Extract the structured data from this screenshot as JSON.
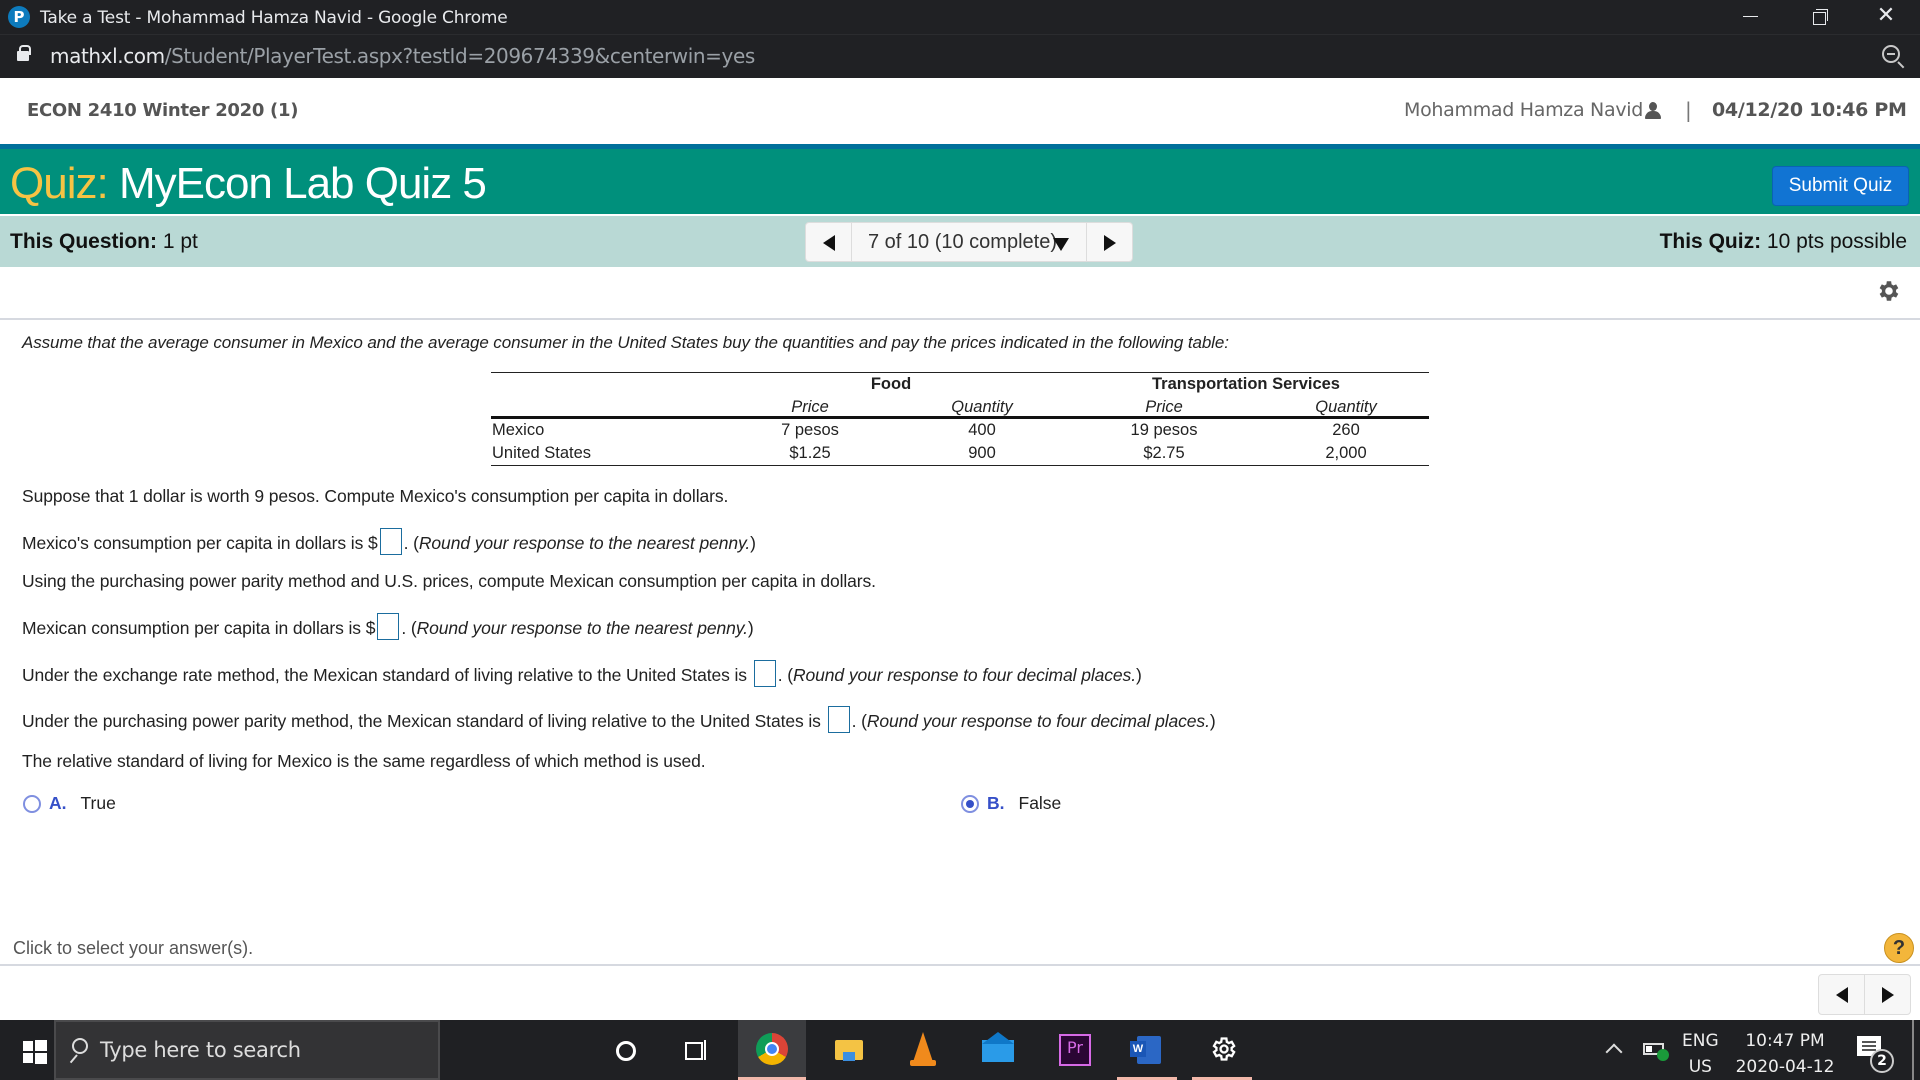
{
  "browser": {
    "window_title": "Take a Test - Mohammad Hamza Navid - Google Chrome",
    "app_logo_letter": "P",
    "url_host": "mathxl.com",
    "url_path": "/Student/PlayerTest.aspx?testId=209674339&centerwin=yes",
    "close_glyph": "✕"
  },
  "course": {
    "name": "ECON 2410 Winter 2020 (1)",
    "user_name": "Mohammad Hamza Navid",
    "separator": "|",
    "datetime": "04/12/20 10:46 PM"
  },
  "quiz": {
    "label": "Quiz:",
    "name": "MyEcon Lab Quiz 5",
    "submit_label": "Submit Quiz",
    "this_question_label": "This Question:",
    "this_question_value": "1 pt",
    "this_quiz_label": "This Quiz:",
    "this_quiz_value": "10 pts possible",
    "pager_label": "7 of 10 (10 complete)",
    "current_question": 7,
    "total_questions": 10,
    "completed": 10
  },
  "question": {
    "intro": "Assume that the average consumer in Mexico and the average consumer in the United States buy the quantities and pay the prices indicated in the following table:",
    "table": {
      "groups": [
        "Food",
        "Transportation Services"
      ],
      "subheaders": [
        "Price",
        "Quantity",
        "Price",
        "Quantity"
      ],
      "rows": [
        {
          "country": "Mexico",
          "values": [
            "7 pesos",
            "400",
            "19 pesos",
            "260"
          ]
        },
        {
          "country": "United States",
          "values": [
            "$1.25",
            "900",
            "$2.75",
            "2,000"
          ]
        }
      ]
    },
    "lines": [
      {
        "before": "Suppose that 1 dollar is worth 9 pesos. Compute Mexico's consumption per capita in dollars."
      },
      {
        "before": "Mexico's consumption per capita in dollars is $",
        "input_value": "",
        "after": ". (",
        "hint": "Round your response to the nearest penny.",
        "close": ")"
      },
      {
        "before": "Using the purchasing power parity method and U.S. prices, compute Mexican consumption per capita in dollars."
      },
      {
        "before": "Mexican consumption per capita in dollars is $",
        "input_value": "",
        "after": ". (",
        "hint": "Round your response to the nearest penny.",
        "close": ")"
      },
      {
        "before": "Under the exchange rate method, the Mexican standard of living relative to the United States is ",
        "input_value": "",
        "after": ". (",
        "hint": "Round your response to four decimal places.",
        "close": ")"
      },
      {
        "before": "Under the purchasing power parity method, the Mexican standard of living relative to the United States is ",
        "input_value": "",
        "after": ". (",
        "hint": "Round your response to four decimal places.",
        "close": ")"
      },
      {
        "before": "The relative standard of living for Mexico is the same regardless of which method is used."
      }
    ],
    "options": [
      {
        "letter": "A.",
        "text": "True",
        "selected": false
      },
      {
        "letter": "B.",
        "text": "False",
        "selected": true
      }
    ]
  },
  "footer": {
    "hint": "Click to select your answer(s).",
    "help_glyph": "?"
  },
  "taskbar": {
    "search_placeholder": "Type here to search",
    "apps": [
      "cortana",
      "task-view",
      "chrome",
      "file-explorer",
      "vlc",
      "mail",
      "premiere-pro",
      "word",
      "settings"
    ],
    "lang_top": "ENG",
    "lang_bottom": "US",
    "time": "10:47 PM",
    "date": "2020-04-12",
    "notification_count": "2"
  },
  "colors": {
    "quiz_bar": "#00907c",
    "quiz_label": "#f6c344",
    "info_bar": "#b9d9d5",
    "submit_button": "#1174d3",
    "radio_accent": "#3650c8"
  }
}
